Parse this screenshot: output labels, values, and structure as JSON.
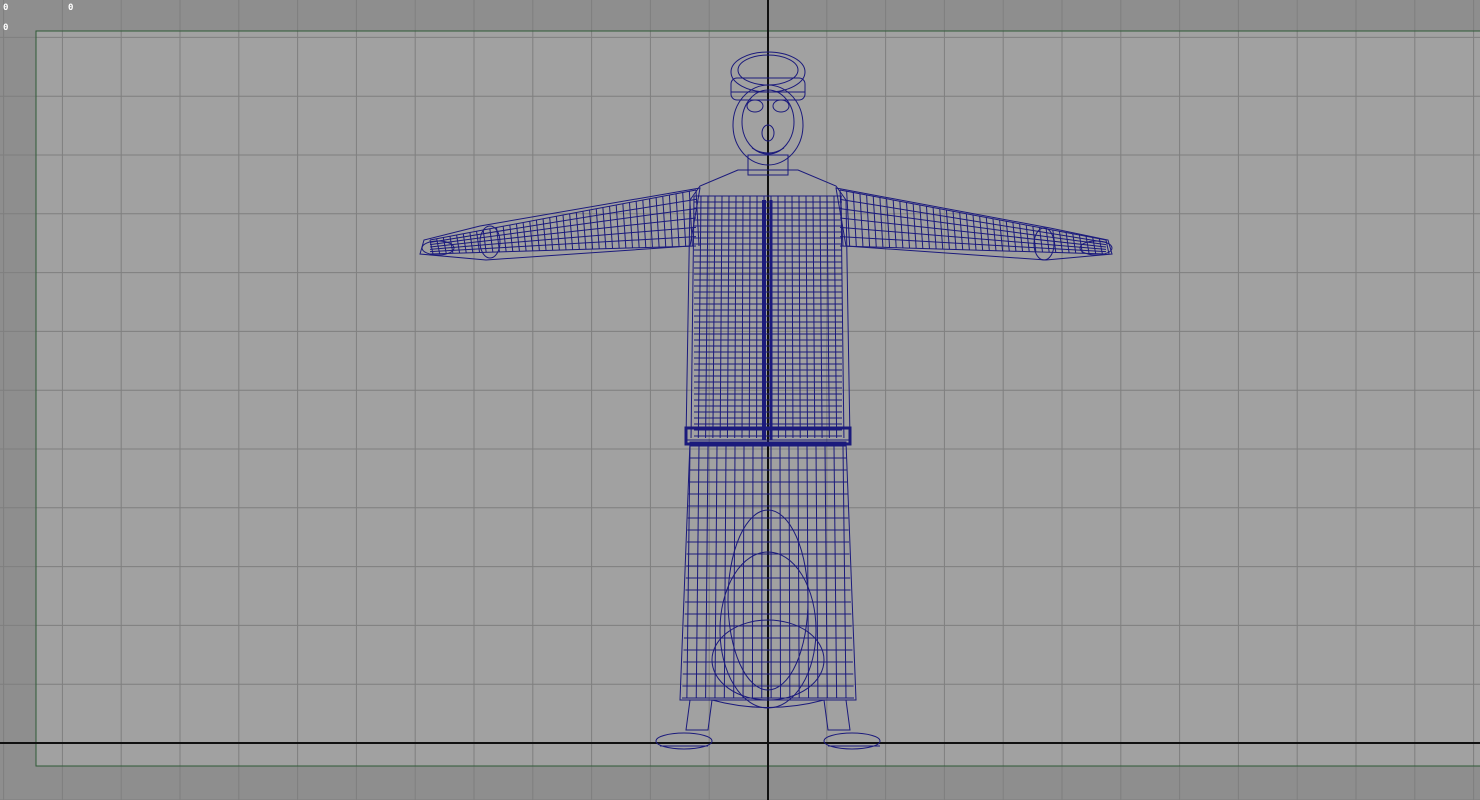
{
  "hud": {
    "counter_a": "0",
    "counter_b": "0",
    "counter_c": "0"
  },
  "viewport": {
    "view": "front",
    "display_mode": "wireframe",
    "colors": {
      "background": "#8e8e8e",
      "film_gate_fill": "#a1a1a1",
      "grid_line": "#7f7f7f",
      "film_gate_border": "#2f5a37",
      "axis_line": "#101010",
      "wireframe": "#1b1a7c",
      "hud_text": "#ffffff"
    }
  },
  "model": {
    "name": "",
    "pose": "t-pose"
  }
}
